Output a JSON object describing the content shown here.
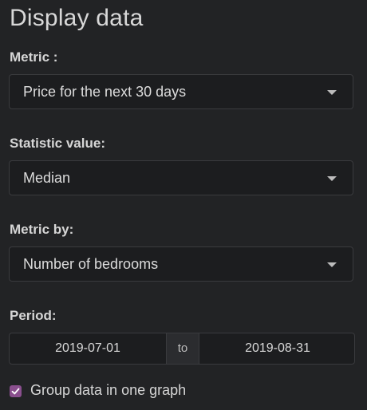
{
  "panel": {
    "title": "Display data"
  },
  "metric": {
    "label": "Metric :",
    "value": "Price for the next 30 days"
  },
  "statistic": {
    "label": "Statistic value:",
    "value": "Median"
  },
  "metric_by": {
    "label": "Metric by:",
    "value": "Number of bedrooms"
  },
  "period": {
    "label": "Period:",
    "start": "2019-07-01",
    "separator": "to",
    "end": "2019-08-31"
  },
  "group": {
    "label": "Group data in one graph",
    "checked": true,
    "accent_color": "#8a4f8e"
  },
  "icons": {
    "dropdown": "chevron-down-icon",
    "check": "check-icon"
  }
}
